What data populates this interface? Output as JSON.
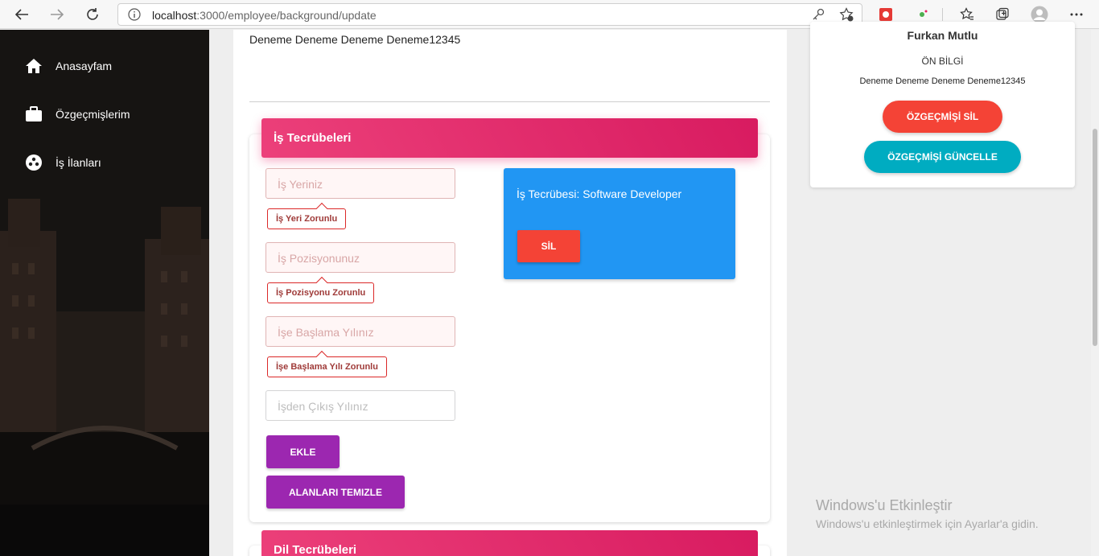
{
  "browser": {
    "url_host": "localhost",
    "url_rest": ":3000/employee/background/update"
  },
  "sidebar": {
    "items": [
      {
        "label": "Anasayfam",
        "icon": "home-icon"
      },
      {
        "label": "Özgeçmişlerim",
        "icon": "briefcase-icon"
      },
      {
        "label": "İş İlanları",
        "icon": "sports-ball-icon"
      }
    ]
  },
  "main": {
    "summary_text": "Deneme Deneme Deneme Deneme12345",
    "experience": {
      "title": "İş Tecrübeleri",
      "fields": {
        "workplace_placeholder": "İş Yeriniz",
        "position_placeholder": "İş Pozisyonunuz",
        "start_year_placeholder": "İşe Başlama Yılınız",
        "end_year_placeholder": "İşden Çıkış Yılınız"
      },
      "errors": {
        "workplace": "İş Yeri Zorunlu",
        "position": "İş Pozisyonu Zorunlu",
        "start_year": "İşe Başlama Yılı Zorunlu"
      },
      "buttons": {
        "add": "EKLE",
        "clear": "ALANLARI TEMIZLE"
      },
      "entry": {
        "text": "İş Tecrübesi: Software Developer",
        "delete": "SİL"
      }
    },
    "languages": {
      "title": "Dil Tecrübeleri"
    }
  },
  "profile": {
    "name": "Furkan Mutlu",
    "subtitle": "ÖN BİLGİ",
    "summary": "Deneme Deneme Deneme Deneme12345",
    "delete_button": "ÖZGEÇMİŞİ SİL",
    "update_button": "ÖZGEÇMİŞİ GÜNCELLE"
  },
  "watermark": {
    "title": "Windows'u Etkinleştir",
    "subtitle": "Windows'u etkinleştirmek için Ayarlar'a gidin."
  },
  "colors": {
    "pink": "#e91e63",
    "purple": "#9c27b0",
    "blue": "#2196f3",
    "red": "#f44336",
    "cyan": "#00acc1"
  }
}
